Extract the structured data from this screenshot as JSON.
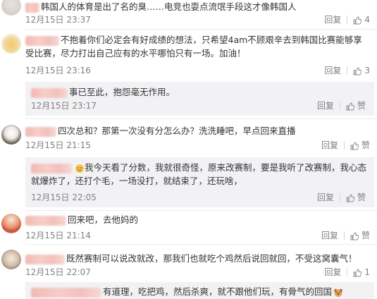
{
  "reply_label": "回复",
  "like_label": "赞",
  "comments": [
    {
      "text": "韩国人的体育是出了名的臭……电竞也耍点流氓手段这才像韩国人",
      "time": "12月15日 23:37",
      "likes": "4"
    },
    {
      "text": "不抱着你们必定会有好成绩的想法，只希望4am不顾艰辛去到韩国比赛能够享受比赛，尽力打出自己应有的水平哪怕只有一场。加油！",
      "time": "12月15日 23:16",
      "likes": "3",
      "reply": {
        "text": "事已至此，抱怨毫无作用。",
        "time": "12月15日 23:17"
      }
    },
    {
      "text": "四次总和？那第一次没有分怎么办？洗洗睡吧，早点回来直播",
      "time": "12月15日 21:15",
      "reply": {
        "text": "我今天看了分数，我就很奇怪，原来改赛制，要是我听了改赛制，我心态就爆炸了，还打个毛，一场没打，就结束了，还玩啥，",
        "time": "12月15日 22:05"
      }
    },
    {
      "text": "回来吧，去他妈的",
      "time": "12月15日 21:14"
    },
    {
      "text": "既然赛制可以说改就改，那我们也就吃个鸡然后说回就回，不受这窝囊气！",
      "time": "12月15日 22:07",
      "likes": "1"
    },
    {
      "text": "有道理，吃把鸡，然后杀爽，就不跟他们玩，有骨气的回国"
    }
  ]
}
